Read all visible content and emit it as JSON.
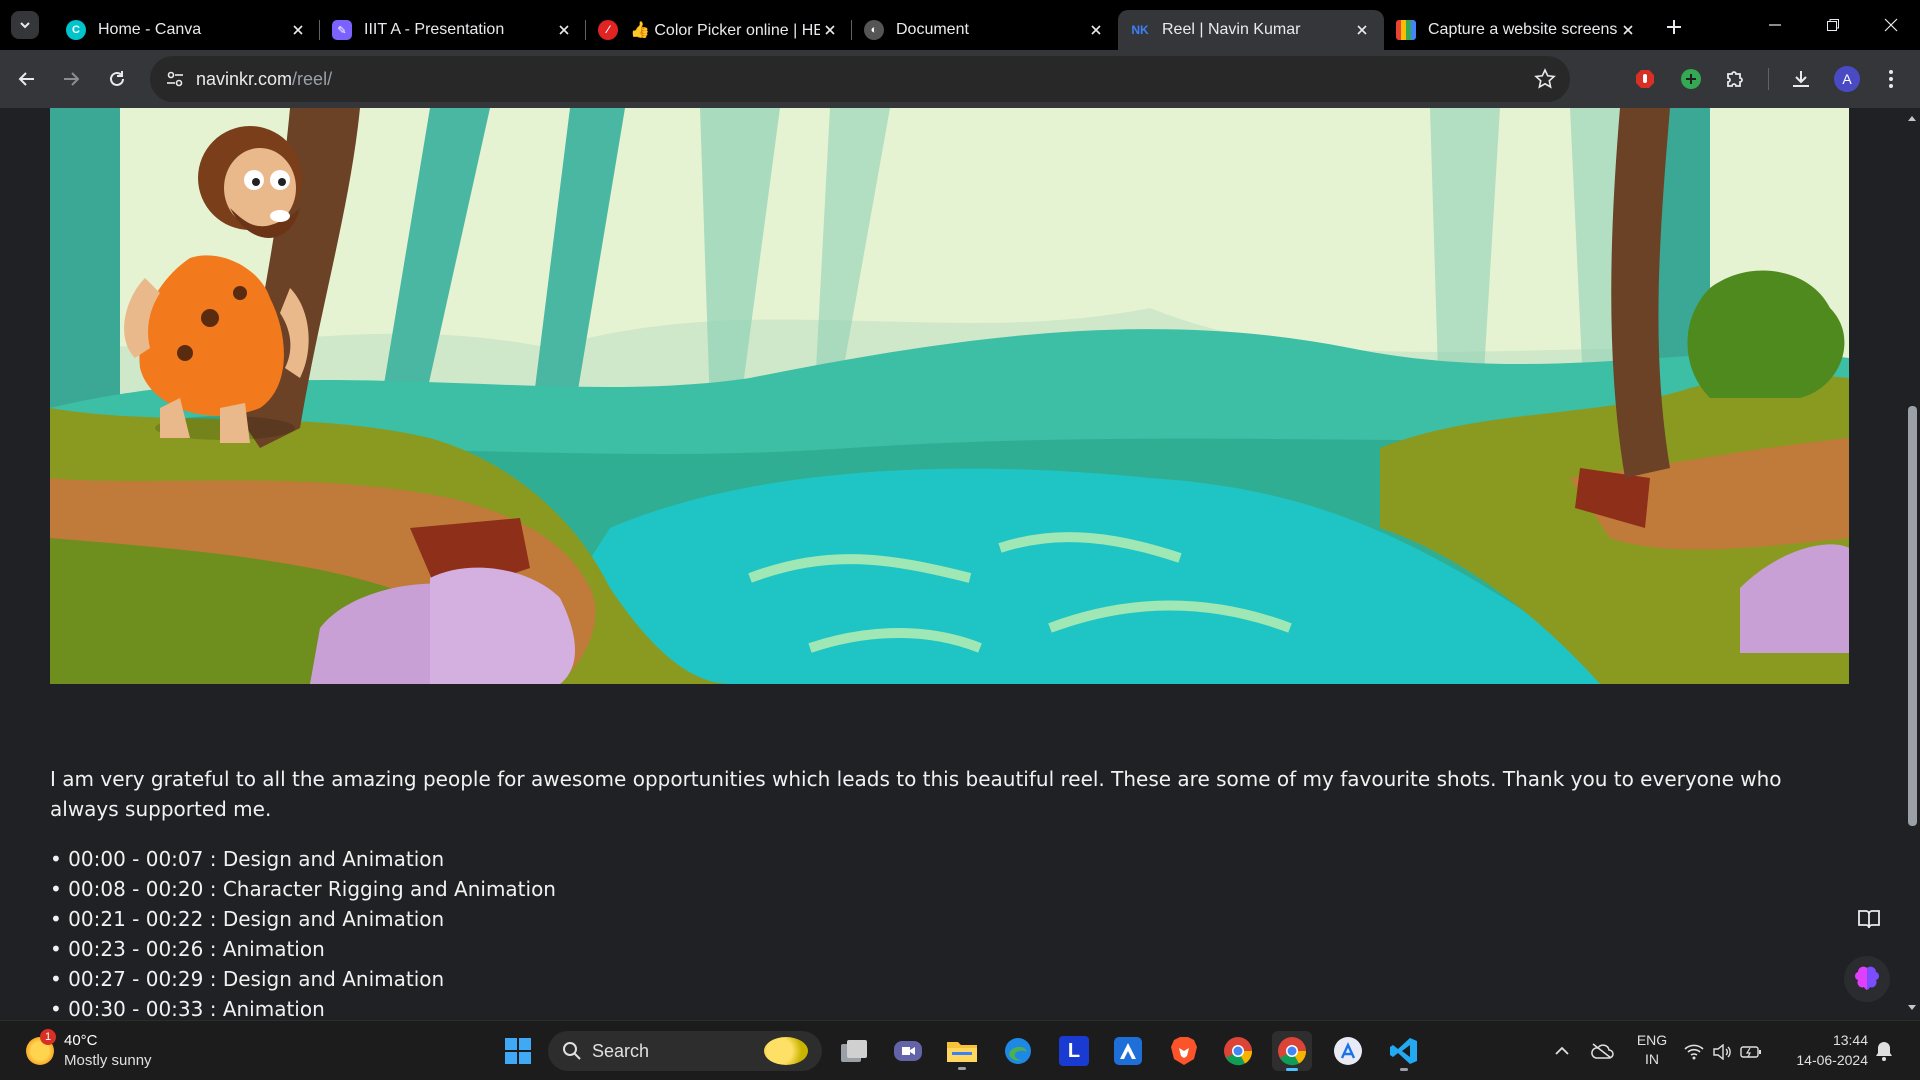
{
  "browser": {
    "tabs": [
      {
        "title": "Home - Canva",
        "favicon": "canva-icon",
        "color": "#00c4cc"
      },
      {
        "title": "IIIT A - Presentation",
        "favicon": "presentation-icon",
        "color": "#7b61ff"
      },
      {
        "title": "👍 Color Picker online | HE",
        "favicon": "color-picker-icon",
        "color": "#e02424"
      },
      {
        "title": "Document",
        "favicon": "document-icon",
        "color": "#888888"
      },
      {
        "title": "Reel | Navin Kumar",
        "favicon": "nk-icon",
        "color": "#3b82f6",
        "active": true
      },
      {
        "title": "Capture a website screensh",
        "favicon": "screenshot-icon",
        "color": "#f59e0b"
      }
    ],
    "url": {
      "host": "navinkr.com",
      "path": "/reel/"
    },
    "profile_initial": "A"
  },
  "page": {
    "description": "I am very grateful to all the amazing people for awesome opportunities which leads to this beautiful reel. These are some of my favourite shots. Thank you to everyone who always supported me.",
    "timeline": [
      "• 00:00 - 00:07 : Design and Animation",
      "• 00:08 - 00:20 : Character Rigging and Animation",
      "• 00:21 - 00:22 : Design and Animation",
      "• 00:23 - 00:26 : Animation",
      "• 00:27 - 00:29 : Design and Animation",
      "• 00:30 - 00:33 : Animation"
    ]
  },
  "taskbar": {
    "weather": {
      "temp": "40°C",
      "condition": "Mostly sunny",
      "badge": "1"
    },
    "search_placeholder": "Search",
    "lang": {
      "line1": "ENG",
      "line2": "IN"
    },
    "time": "13:44",
    "date": "14-06-2024"
  }
}
